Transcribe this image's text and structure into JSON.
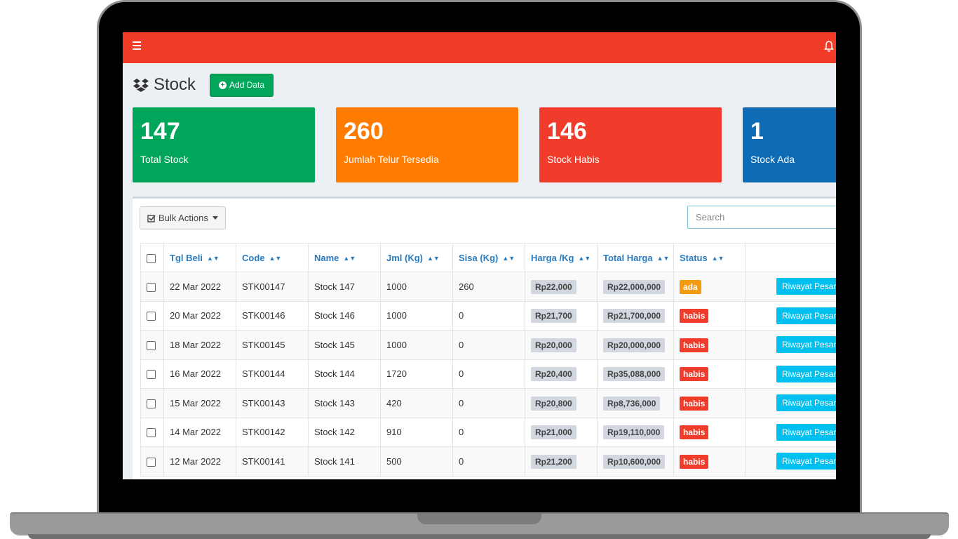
{
  "colors": {
    "topbar": "#f33c28",
    "green": "#00a65a",
    "orange": "#ff7c00",
    "red": "#f23c2b",
    "blue": "#0f6bb3",
    "status_ada": "#f39c12",
    "status_habis": "#f23c2b",
    "info": "#00c0ef"
  },
  "header": {
    "title": "Stock",
    "add_label": "Add Data",
    "menu_icon": "hamburger-icon",
    "notification_icon": "bell-icon"
  },
  "stats": [
    {
      "value": "147",
      "label": "Total Stock"
    },
    {
      "value": "260",
      "label": "Jumlah Telur Tersedia"
    },
    {
      "value": "146",
      "label": "Stock Habis"
    },
    {
      "value": "1",
      "label": "Stock Ada"
    }
  ],
  "toolbar": {
    "bulk_label": "Bulk Actions",
    "search_placeholder": "Search"
  },
  "table": {
    "columns": [
      "Tgl Beli",
      "Code",
      "Name",
      "Jml (Kg)",
      "Sisa (Kg)",
      "Harga /Kg",
      "Total Harga",
      "Status"
    ],
    "action_label": "Riwayat Pesan",
    "rows": [
      {
        "tgl": "22 Mar 2022",
        "code": "STK00147",
        "name": "Stock 147",
        "jml": "1000",
        "sisa": "260",
        "harga": "Rp22,000",
        "total": "Rp22,000,000",
        "status": "ada"
      },
      {
        "tgl": "20 Mar 2022",
        "code": "STK00146",
        "name": "Stock 146",
        "jml": "1000",
        "sisa": "0",
        "harga": "Rp21,700",
        "total": "Rp21,700,000",
        "status": "habis"
      },
      {
        "tgl": "18 Mar 2022",
        "code": "STK00145",
        "name": "Stock 145",
        "jml": "1000",
        "sisa": "0",
        "harga": "Rp20,000",
        "total": "Rp20,000,000",
        "status": "habis"
      },
      {
        "tgl": "16 Mar 2022",
        "code": "STK00144",
        "name": "Stock 144",
        "jml": "1720",
        "sisa": "0",
        "harga": "Rp20,400",
        "total": "Rp35,088,000",
        "status": "habis"
      },
      {
        "tgl": "15 Mar 2022",
        "code": "STK00143",
        "name": "Stock 143",
        "jml": "420",
        "sisa": "0",
        "harga": "Rp20,800",
        "total": "Rp8,736,000",
        "status": "habis"
      },
      {
        "tgl": "14 Mar 2022",
        "code": "STK00142",
        "name": "Stock 142",
        "jml": "910",
        "sisa": "0",
        "harga": "Rp21,000",
        "total": "Rp19,110,000",
        "status": "habis"
      },
      {
        "tgl": "12 Mar 2022",
        "code": "STK00141",
        "name": "Stock 141",
        "jml": "500",
        "sisa": "0",
        "harga": "Rp21,200",
        "total": "Rp10,600,000",
        "status": "habis"
      }
    ]
  }
}
